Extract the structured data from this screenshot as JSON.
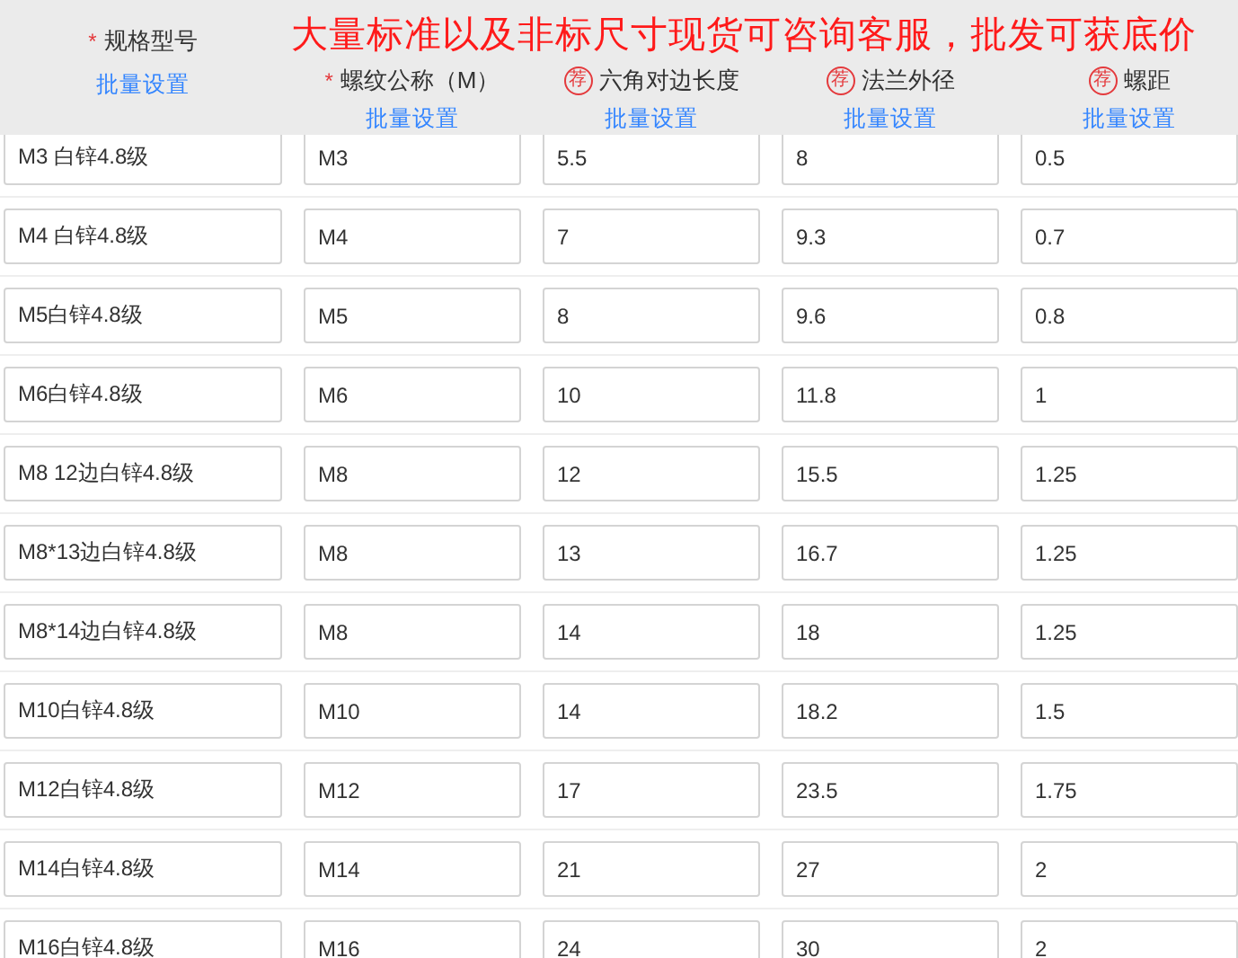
{
  "banner": "大量标准以及非标尺寸现货可咨询客服，批发可获底价",
  "columns": [
    {
      "required_mark": "*",
      "label": "规格型号",
      "batch_link": "批量设置"
    },
    {
      "required_mark": "*",
      "label": "螺纹公称（M）",
      "batch_link": "批量设置"
    },
    {
      "badge": "荐",
      "label": "六角对边长度",
      "batch_link": "批量设置"
    },
    {
      "badge": "荐",
      "label": "法兰外径",
      "batch_link": "批量设置"
    },
    {
      "badge": "荐",
      "label": "螺距",
      "batch_link": "批量设置"
    }
  ],
  "rows": [
    [
      "M3 白锌4.8级",
      "M3",
      "5.5",
      "8",
      "0.5"
    ],
    [
      "M4 白锌4.8级",
      "M4",
      "7",
      "9.3",
      "0.7"
    ],
    [
      "M5白锌4.8级",
      "M5",
      "8",
      "9.6",
      "0.8"
    ],
    [
      "M6白锌4.8级",
      "M6",
      "10",
      "11.8",
      "1"
    ],
    [
      "M8 12边白锌4.8级",
      "M8",
      "12",
      "15.5",
      "1.25"
    ],
    [
      "M8*13边白锌4.8级",
      "M8",
      "13",
      "16.7",
      "1.25"
    ],
    [
      "M8*14边白锌4.8级",
      "M8",
      "14",
      "18",
      "1.25"
    ],
    [
      "M10白锌4.8级",
      "M10",
      "14",
      "18.2",
      "1.5"
    ],
    [
      "M12白锌4.8级",
      "M12",
      "17",
      "23.5",
      "1.75"
    ],
    [
      "M14白锌4.8级",
      "M14",
      "21",
      "27",
      "2"
    ],
    [
      "M16白锌4.8级",
      "M16",
      "24",
      "30",
      "2"
    ]
  ]
}
